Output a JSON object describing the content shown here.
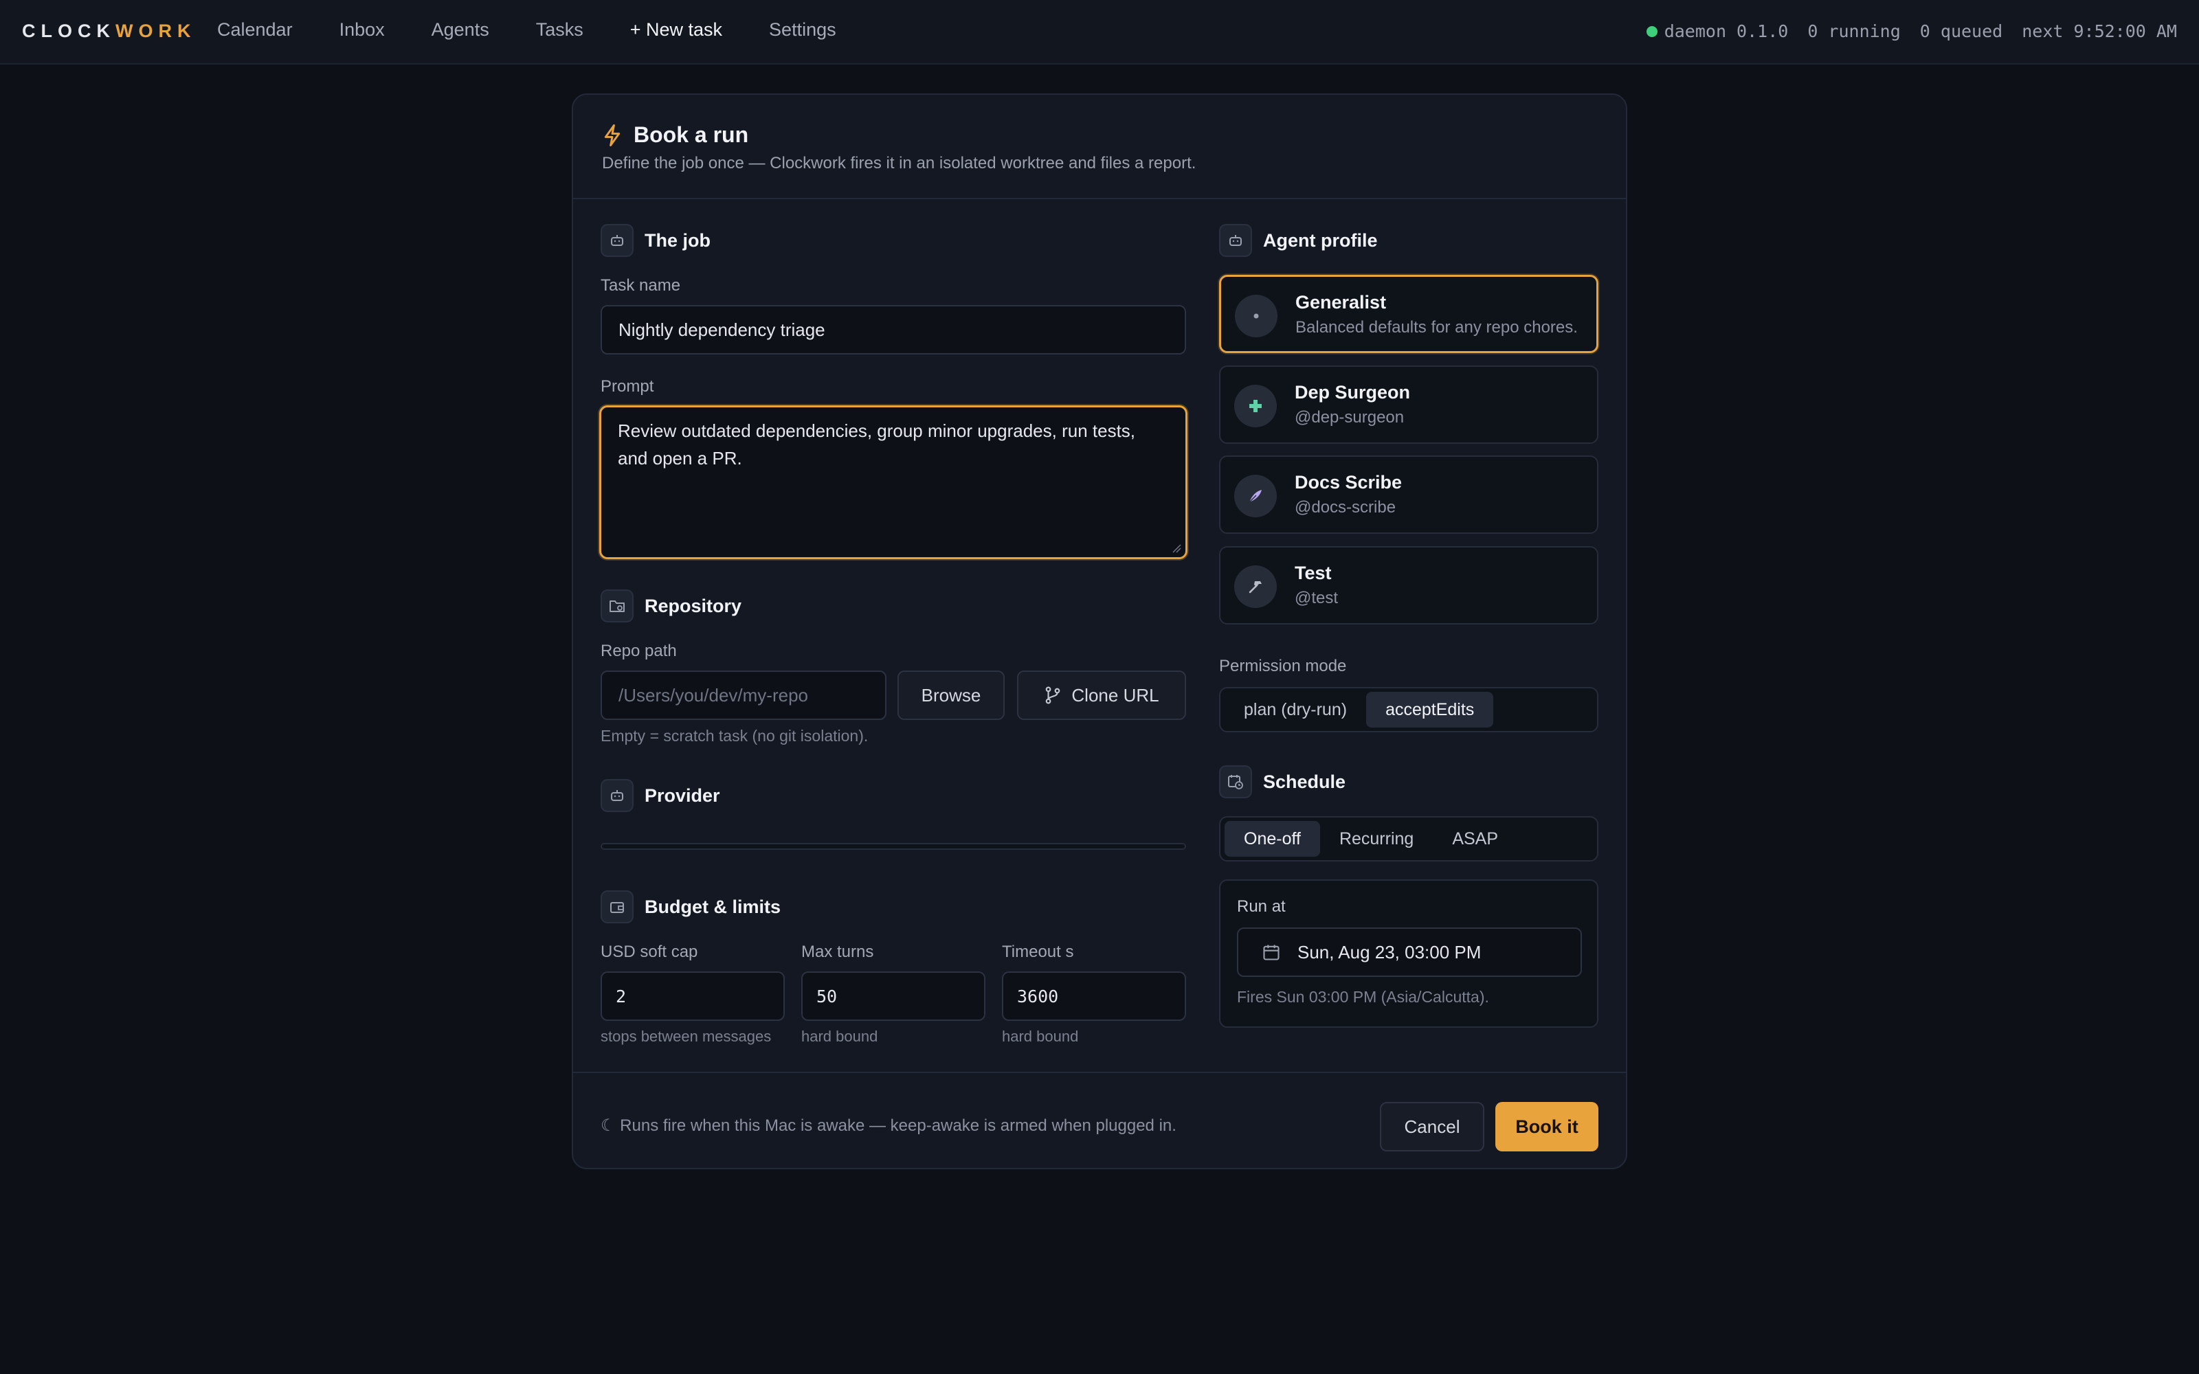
{
  "brand": {
    "part1": "CLOCK",
    "part2": "WORK"
  },
  "nav": {
    "calendar": "Calendar",
    "inbox": "Inbox",
    "agents": "Agents",
    "tasks": "Tasks",
    "new_task": "+ New task",
    "settings": "Settings"
  },
  "status": {
    "daemon": "daemon 0.1.0",
    "running": "0 running",
    "queued": "0 queued",
    "next": "next 9:52:00 AM",
    "dot_color": "#3ecf7a"
  },
  "card": {
    "title": "Book a run",
    "subtitle": "Define the job once — Clockwork fires it in an isolated worktree and files a report."
  },
  "job": {
    "heading": "The job",
    "task_name_label": "Task name",
    "task_name_value": "Nightly dependency triage",
    "prompt_label": "Prompt",
    "prompt_value": "Review outdated dependencies, group minor upgrades, run tests, and open a PR."
  },
  "repository": {
    "heading": "Repository",
    "repo_path_label": "Repo path",
    "repo_path_placeholder": "/Users/you/dev/my-repo",
    "browse_label": "Browse",
    "clone_label": "Clone URL",
    "hint": "Empty = scratch task (no git isolation)."
  },
  "provider": {
    "heading": "Provider"
  },
  "budget": {
    "heading": "Budget & limits",
    "usd_label": "USD soft cap",
    "usd_value": "2",
    "usd_hint": "stops between messages",
    "turns_label": "Max turns",
    "turns_value": "50",
    "turns_hint": "hard bound",
    "timeout_label": "Timeout s",
    "timeout_value": "3600",
    "timeout_hint": "hard bound"
  },
  "agent_profile": {
    "heading": "Agent profile",
    "agents": [
      {
        "name": "Generalist",
        "sub": "Balanced defaults for any repo chores.",
        "icon": "dot-icon",
        "selected": true
      },
      {
        "name": "Dep Surgeon",
        "sub": "@dep-surgeon",
        "icon": "plus-icon",
        "selected": false
      },
      {
        "name": "Docs Scribe",
        "sub": "@docs-scribe",
        "icon": "quill-icon",
        "selected": false
      },
      {
        "name": "Test",
        "sub": "@test",
        "icon": "hammer-icon",
        "selected": false
      }
    ]
  },
  "permission": {
    "label": "Permission mode",
    "options": [
      "plan (dry-run)",
      "acceptEdits"
    ],
    "active": "acceptEdits"
  },
  "schedule": {
    "heading": "Schedule",
    "options": [
      "One-off",
      "Recurring",
      "ASAP"
    ],
    "active": "One-off",
    "run_at_label": "Run at",
    "run_at_value": "Sun, Aug 23, 03:00 PM",
    "fires_note": "Fires Sun 03:00 PM (Asia/Calcutta)."
  },
  "footer": {
    "note": "☾ Runs fire when this Mac is awake — keep-awake is armed when plugged in.",
    "cancel_label": "Cancel",
    "book_label": "Book it"
  },
  "colors": {
    "accent": "#e8a33d",
    "background": "#0d1017",
    "card": "#131823"
  }
}
